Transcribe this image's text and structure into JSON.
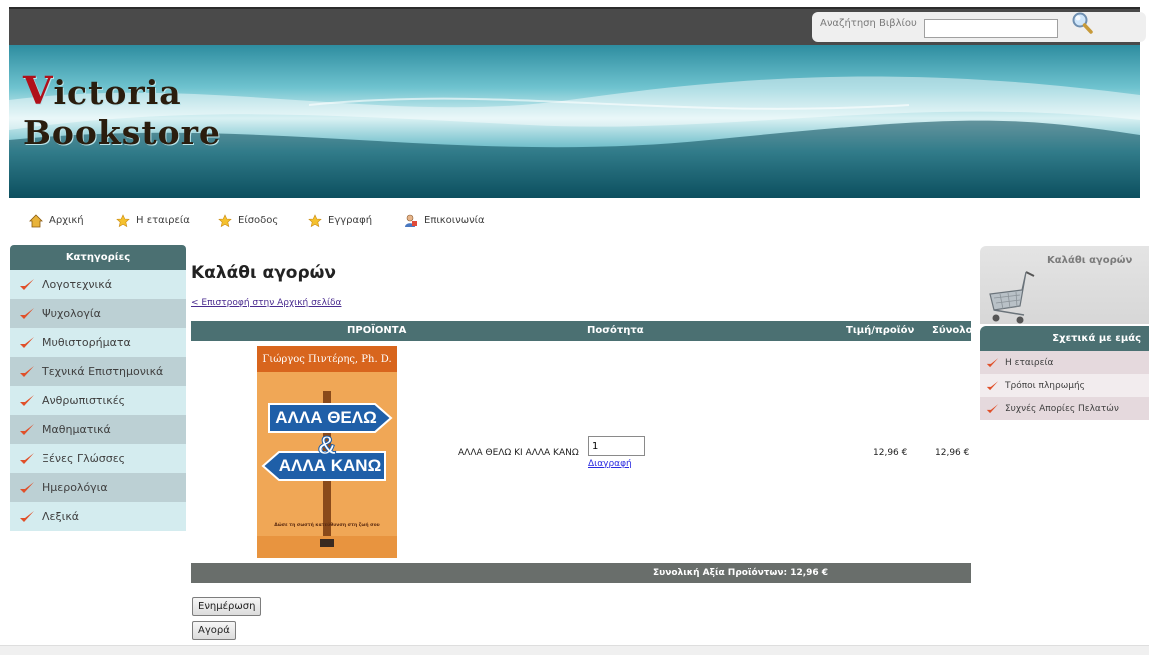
{
  "search": {
    "label": "Αναζήτηση Βιβλίου",
    "value": "",
    "icon": "magnifier-icon"
  },
  "logo": {
    "first_letter": "V",
    "line1_rest": "ictoria",
    "line2": "Bookstore"
  },
  "nav": [
    {
      "label": "Αρχική",
      "icon": "home-icon"
    },
    {
      "label": "Η εταιρεία",
      "icon": "star-icon"
    },
    {
      "label": "Είσοδος",
      "icon": "star-icon"
    },
    {
      "label": "Εγγραφή",
      "icon": "star-icon"
    },
    {
      "label": "Επικοινωνία",
      "icon": "contact-icon"
    }
  ],
  "categories": {
    "title": "Κατηγορίες",
    "items": [
      "Λογοτεχνικά",
      "Ψυχολογία",
      "Μυθιστορήματα",
      "Τεχνικά Επιστημονικά",
      "Ανθρωπιστικές",
      "Μαθηματικά",
      "Ξένες Γλώσσες",
      "Ημερολόγια",
      "Λεξικά"
    ]
  },
  "cart": {
    "title": "Καλάθι αγορών",
    "back_link": "< Επιστροφή στην Αρχική σελίδα",
    "columns": {
      "products": "ΠΡΟΪΟΝΤΑ",
      "quantity": "Ποσότητα",
      "unit_price": "Τιμή/προϊόν",
      "total": "Σύνολο"
    },
    "item": {
      "book_author": "Γιώργος Πιντέρης, Ph. D.",
      "book_title_top": "ΑΛΛΑ ΘΕΛΩ",
      "book_amp": "&",
      "book_title_bottom": "ΑΛΛΑ ΚΑΝΩ",
      "book_subtitle": "Δώσε τη σωστή κατεύθυνση στη ζωή σου",
      "name": "ΑΛΛΑ ΘΕΛΩ ΚΙ ΑΛΛΑ ΚΑΝΩ",
      "quantity": "1",
      "delete_label": "Διαγραφή",
      "unit_price": "12,96 €",
      "total": "12,96 €"
    },
    "grand_total": "Συνολική Αξία Προϊόντων: 12,96 €",
    "update_button": "Ενημέρωση",
    "buy_button": "Αγορά"
  },
  "right_sidebar": {
    "cart_title": "Καλάθι αγορών",
    "about_title": "Σχετικά με εμάς",
    "about_items": [
      "Η εταιρεία",
      "Τρόποι πληρωμής",
      "Συχνές Απορίες Πελατών"
    ]
  },
  "colors": {
    "accent": "#4b7072",
    "check": "#e0502a",
    "topbar": "#4a4a4a"
  }
}
